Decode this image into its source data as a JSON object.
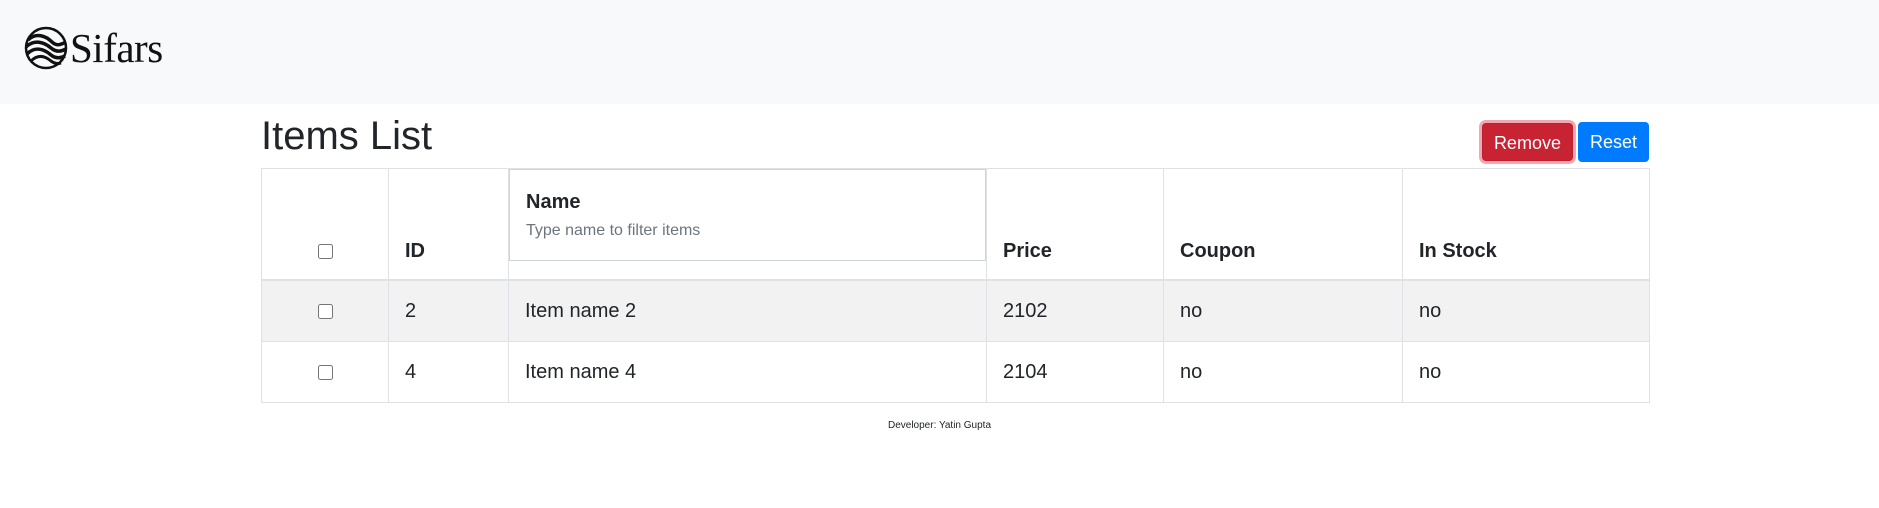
{
  "brand": {
    "name": "Sifars",
    "logo_icon": "sifars-wave-logo-icon"
  },
  "page": {
    "title": "Items List"
  },
  "actions": {
    "remove_label": "Remove",
    "reset_label": "Reset"
  },
  "colors": {
    "danger": "#c82333",
    "primary": "#007bff",
    "navbar_bg": "#f8f9fa",
    "stripe": "#f2f2f2"
  },
  "table": {
    "headers": {
      "id": "ID",
      "name": "Name",
      "name_filter_placeholder": "Type name to filter items",
      "price": "Price",
      "coupon": "Coupon",
      "in_stock": "In Stock"
    },
    "rows": [
      {
        "id": "2",
        "name": "Item name 2",
        "price": "2102",
        "coupon": "no",
        "in_stock": "no",
        "checked": false
      },
      {
        "id": "4",
        "name": "Item name 4",
        "price": "2104",
        "coupon": "no",
        "in_stock": "no",
        "checked": false
      }
    ]
  },
  "footer": {
    "text": "Developer: Yatin Gupta"
  }
}
